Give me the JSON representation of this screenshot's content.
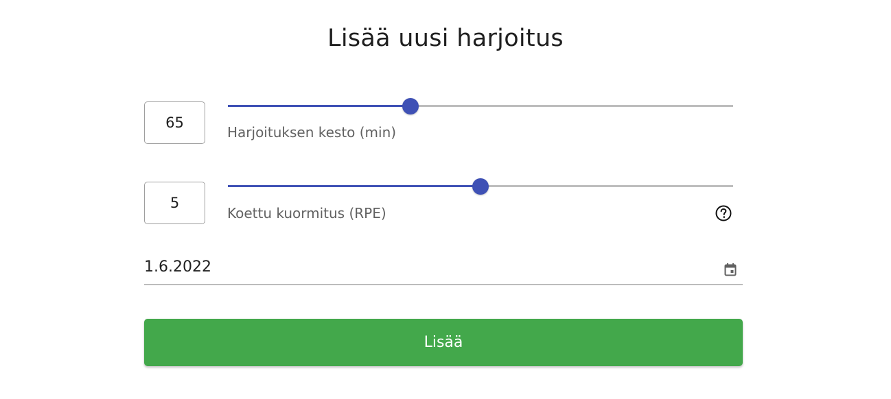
{
  "form": {
    "title": "Lisää uusi harjoitus",
    "duration": {
      "value": "65",
      "label": "Harjoituksen kesto (min)",
      "slider_fraction": 0.362
    },
    "rpe": {
      "value": "5",
      "label": "Koettu kuormitus (RPE)",
      "slider_fraction": 0.5
    },
    "date": {
      "value": "1.6.2022"
    },
    "submit_label": "Lisää"
  },
  "colors": {
    "accent": "#3f51b5",
    "rail": "#bdbdbd",
    "button": "#43a84b"
  },
  "icons": {
    "help": "help-circle-icon",
    "calendar": "calendar-icon"
  }
}
